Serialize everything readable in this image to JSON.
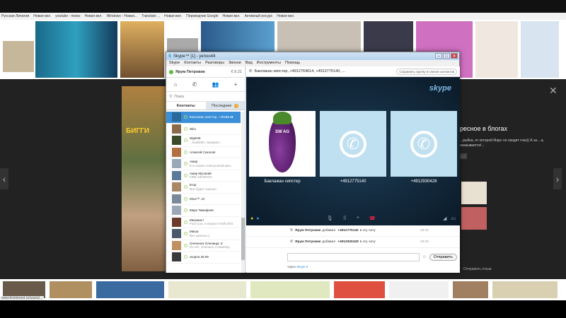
{
  "browser": {
    "bookmarks": [
      "Русская Липатия",
      "Новая вкл.",
      "youtube - поиск",
      "Новая вкл.",
      "Windows - Новая...",
      "Translate ...",
      "Новая вкл.",
      "Переводчик Google",
      "Новая вкл.",
      "Активный ресурс",
      "Новая вкл."
    ],
    "status_url": "www.livinternet.ru/users/..."
  },
  "overlay": {
    "side_title": "ресное в блогах",
    "side_desc": "...рыбка, от которой Марс не сводит глаз)) А за ...а, оказывается!...",
    "side_tag": "...",
    "send_link": "Отправить отзыв",
    "close_label": "✕",
    "prev_label": "‹",
    "next_label": "›",
    "game_text": "БИГГИ"
  },
  "skype": {
    "window_title": "Skype™ [1] - yenoo44",
    "window_buttons": [
      "–",
      "□",
      "✕"
    ],
    "menu": [
      "Skype",
      "Контакты",
      "Разговоры",
      "Звонки",
      "Вид",
      "Инструменты",
      "Помощь"
    ],
    "profile_name": "Ярум Петровик",
    "credit": "€ 6.21",
    "search_placeholder": "Поиск",
    "tabs": {
      "contacts": "Контакты",
      "recent": "Последние",
      "recent_badge": "3"
    },
    "contacts": [
      {
        "name": "Баклажан хипстер, +4912... ×",
        "msg": "",
        "time": "14:41",
        "selected": true
      },
      {
        "name": "Niko",
        "msg": ""
      },
      {
        "name": "Wget36",
        "msg": "...бомбайт, лакарнит..."
      },
      {
        "name": "Алексей Соколов",
        "msg": ""
      },
      {
        "name": "Амир",
        "msg": "Кто играет в Батусевой мен..."
      },
      {
        "name": "Амир Мусаний",
        "msg": "FIRE DEORG!!!"
      },
      {
        "name": "Егор",
        "msg": "Все будет хорошо"
      },
      {
        "name": "ebus™ =D",
        "msg": ""
      },
      {
        "name": "Марк Тимофеев",
        "msg": ""
      },
      {
        "name": "Механист",
        "msg": "Fuck you, и играю в Half-Life3"
      },
      {
        "name": "Миша",
        "msg": "Все ужасно=("
      },
      {
        "name": "Олененок Оленища :3",
        "msg": "Ох нет, Оленька, к нашему..."
      },
      {
        "name": "скорпа 28.09",
        "msg": ""
      }
    ],
    "conversation": {
      "title": "Баклажан хипстер, +4912764614, +4912775140, ...",
      "save_label": "Сохранить группу в списке контактов",
      "logo": "skype",
      "participants": [
        {
          "label": "Баклажан хипстер",
          "type": "avatar",
          "avatar_text": "SW AG"
        },
        {
          "label": "+4912775140",
          "type": "phone"
        },
        {
          "label": "+4912930428",
          "type": "phone"
        }
      ],
      "messages": [
        {
          "sender": "Ярум Петровик",
          "text": "добавил",
          "number": "+4912775140",
          "suffix": "в эту чату",
          "time": "20:22"
        },
        {
          "sender": "Ярум Петровик",
          "text": "добавил",
          "number": "+4912930428",
          "suffix": "в эту чату",
          "time": "20:22"
        }
      ],
      "send_label": "Отправить",
      "via_prefix": "через",
      "via_link": "Skype ▾"
    }
  },
  "colors": {
    "accent": "#3a8fd8",
    "call_bg": "#1d3c55",
    "tile_bg": "#bfe0f0",
    "hangup": "#e22244"
  }
}
